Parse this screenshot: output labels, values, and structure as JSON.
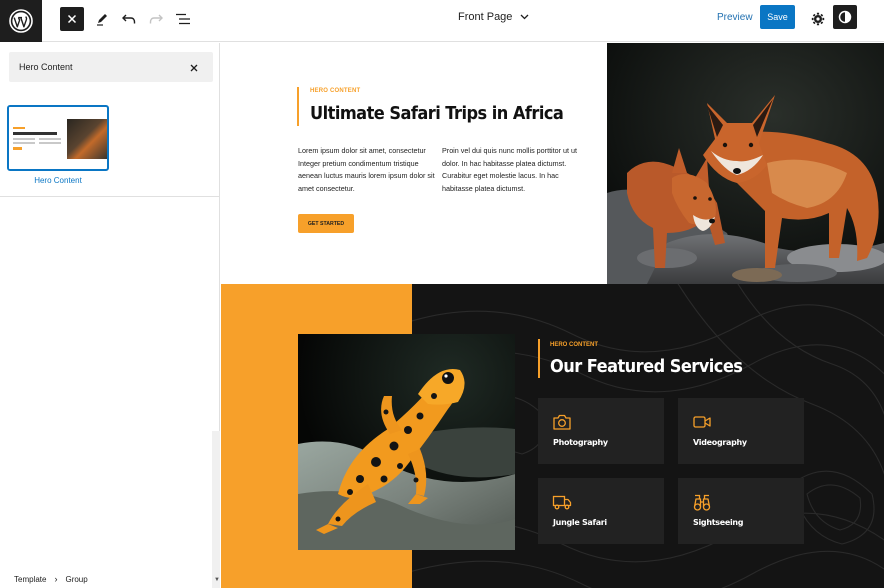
{
  "topbar": {
    "document_title": "Front Page",
    "preview_label": "Preview",
    "save_label": "Save"
  },
  "sidebar": {
    "search_value": "Hero Content",
    "pattern_label": "Hero Content"
  },
  "breadcrumb": {
    "items": [
      "Template",
      "Group"
    ]
  },
  "hero": {
    "eyebrow": "HERO CONTENT",
    "title": "Ultimate Safari Trips in Africa",
    "col1": "Lorem ipsum dolor sit amet, consectetur Integer pretium condimentum tristique aenean luctus mauris lorem ipsum dolor sit amet consectetur.",
    "col2": "Proin vel dui quis nunc mollis porttitor ut ut dolor. In hac habitasse platea dictumst. Curabitur eget molestie lacus. In hac habitasse platea dictumst.",
    "cta_label": "GET STARTED"
  },
  "services": {
    "eyebrow": "HERO CONTENT",
    "title": "Our Featured Services",
    "cards": [
      {
        "label": "Photography",
        "icon": "camera-icon"
      },
      {
        "label": "Videography",
        "icon": "video-camera-icon"
      },
      {
        "label": "Jungle Safari",
        "icon": "truck-icon"
      },
      {
        "label": "Sightseeing",
        "icon": "binoculars-icon"
      }
    ]
  },
  "colors": {
    "accent": "#f7a02a",
    "primary_button": "#0a76c4",
    "dark": "#1e1e1e",
    "services_bg": "#141414",
    "card_bg": "#222222"
  }
}
